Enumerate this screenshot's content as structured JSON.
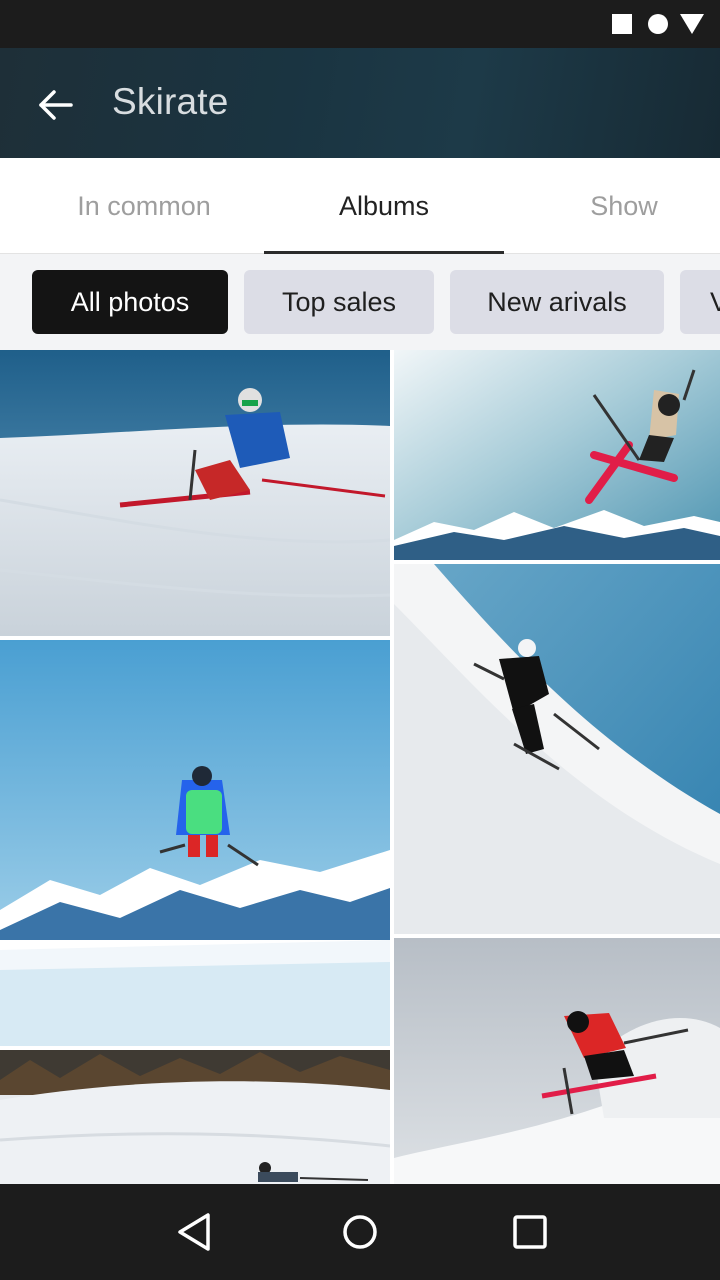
{
  "status_bar": {
    "icons": [
      "square-icon",
      "circle-icon",
      "triangle-icon"
    ]
  },
  "app_bar": {
    "title": "Skirate",
    "back_icon": "arrow-left-icon"
  },
  "tabs": [
    {
      "label": "In common",
      "active": false
    },
    {
      "label": "Albums",
      "active": true
    },
    {
      "label": "Show",
      "active": false
    }
  ],
  "chips": [
    {
      "label": "All photos",
      "selected": true
    },
    {
      "label": "Top sales",
      "selected": false
    },
    {
      "label": "New arivals",
      "selected": false
    },
    {
      "label": "V",
      "selected": false
    }
  ],
  "photos": [
    {
      "subject": "skier carving on groomed slope"
    },
    {
      "subject": "skier jumping with red skis over mountains"
    },
    {
      "subject": "skier with green backpack airborne above mountains"
    },
    {
      "subject": "skier in black descending steep slope"
    },
    {
      "subject": "skier on snowy slope near trees"
    },
    {
      "subject": "skier in red jacket spraying powder"
    }
  ],
  "nav_bar": {
    "icons": [
      "back-triangle-icon",
      "home-circle-icon",
      "recents-square-icon"
    ]
  },
  "colors": {
    "app_bar": "#1d3541",
    "chip_selected": "#141414",
    "chip_default": "#dcdde6",
    "tab_active_text": "#222222",
    "tab_inactive_text": "#9e9e9e"
  }
}
